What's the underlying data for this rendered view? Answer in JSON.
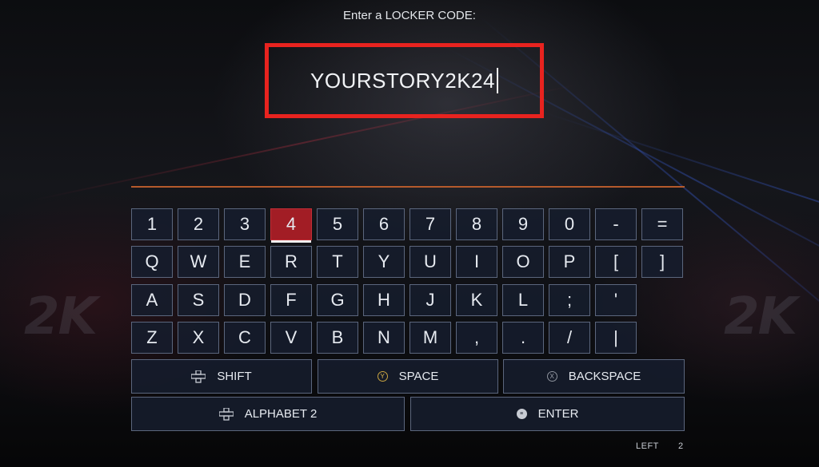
{
  "prompt": "Enter a LOCKER CODE:",
  "code": {
    "value": "YOURSTORY2K24"
  },
  "background": {
    "logo_text": "2K"
  },
  "keyboard": {
    "rows": [
      [
        "1",
        "2",
        "3",
        "4",
        "5",
        "6",
        "7",
        "8",
        "9",
        "0",
        "-",
        "="
      ],
      [
        "Q",
        "W",
        "E",
        "R",
        "T",
        "Y",
        "U",
        "I",
        "O",
        "P",
        "[",
        "]"
      ],
      [
        "A",
        "S",
        "D",
        "F",
        "G",
        "H",
        "J",
        "K",
        "L",
        ";",
        "'"
      ],
      [
        "Z",
        "X",
        "C",
        "V",
        "B",
        "N",
        "M",
        ",",
        ".",
        "/",
        "|"
      ]
    ],
    "selected_key": "4"
  },
  "actions": {
    "shift": {
      "label": "SHIFT",
      "icon": "dpad-icon"
    },
    "space": {
      "label": "SPACE",
      "icon": "y-button-icon",
      "glyph": "Y"
    },
    "backspace": {
      "label": "BACKSPACE",
      "icon": "x-button-icon",
      "glyph": "X"
    },
    "alphabet": {
      "label": "ALPHABET 2",
      "icon": "dpad-icon"
    },
    "enter": {
      "label": "ENTER",
      "icon": "menu-button-icon",
      "glyph": "≡"
    }
  },
  "footer": {
    "left_label": "LEFT",
    "left_value": "2"
  },
  "colors": {
    "highlight_box": "#e8231f",
    "selected_key": "#a21d25",
    "divider": "#b55a2c"
  }
}
